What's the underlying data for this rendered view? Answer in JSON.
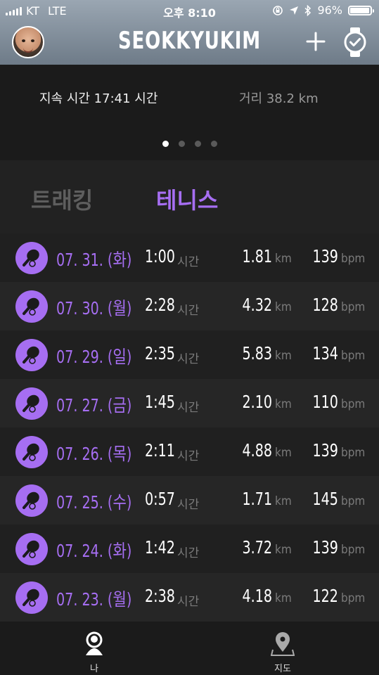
{
  "status_bar": {
    "carrier": "KT",
    "network": "LTE",
    "time": "오후 8:10",
    "battery": "96%",
    "battery_level": 0.96
  },
  "header": {
    "title": "SEOKKYUKIM",
    "add_icon": "plus-icon",
    "device_icon": "watch-check-icon"
  },
  "summary": {
    "duration": "지속 시간 17:41 시간",
    "distance": "거리 38.2 km",
    "page_count": 4,
    "active_page": 0
  },
  "tabs": [
    {
      "label": "트래킹",
      "active": false
    },
    {
      "label": "테니스",
      "active": true
    }
  ],
  "colors": {
    "accent": "#a66ef2",
    "header_top": "#9aa6b2",
    "header_bottom": "#6e7b88"
  },
  "units": {
    "time": "시간",
    "distance": "km",
    "heart": "bpm"
  },
  "sessions": [
    {
      "date": "07. 31. (화)",
      "duration": "1:00",
      "distance": "1.81",
      "bpm": "139"
    },
    {
      "date": "07. 30. (월)",
      "duration": "2:28",
      "distance": "4.32",
      "bpm": "128"
    },
    {
      "date": "07. 29. (일)",
      "duration": "2:35",
      "distance": "5.83",
      "bpm": "134"
    },
    {
      "date": "07. 27. (금)",
      "duration": "1:45",
      "distance": "2.10",
      "bpm": "110"
    },
    {
      "date": "07. 26. (목)",
      "duration": "2:11",
      "distance": "4.88",
      "bpm": "139"
    },
    {
      "date": "07. 25. (수)",
      "duration": "0:57",
      "distance": "1.71",
      "bpm": "145"
    },
    {
      "date": "07. 24. (화)",
      "duration": "1:42",
      "distance": "3.72",
      "bpm": "139"
    },
    {
      "date": "07. 23. (월)",
      "duration": "2:38",
      "distance": "4.18",
      "bpm": "122"
    }
  ],
  "bottom_nav": [
    {
      "label": "나",
      "icon": "person-icon"
    },
    {
      "label": "지도",
      "icon": "map-pin-icon"
    }
  ]
}
